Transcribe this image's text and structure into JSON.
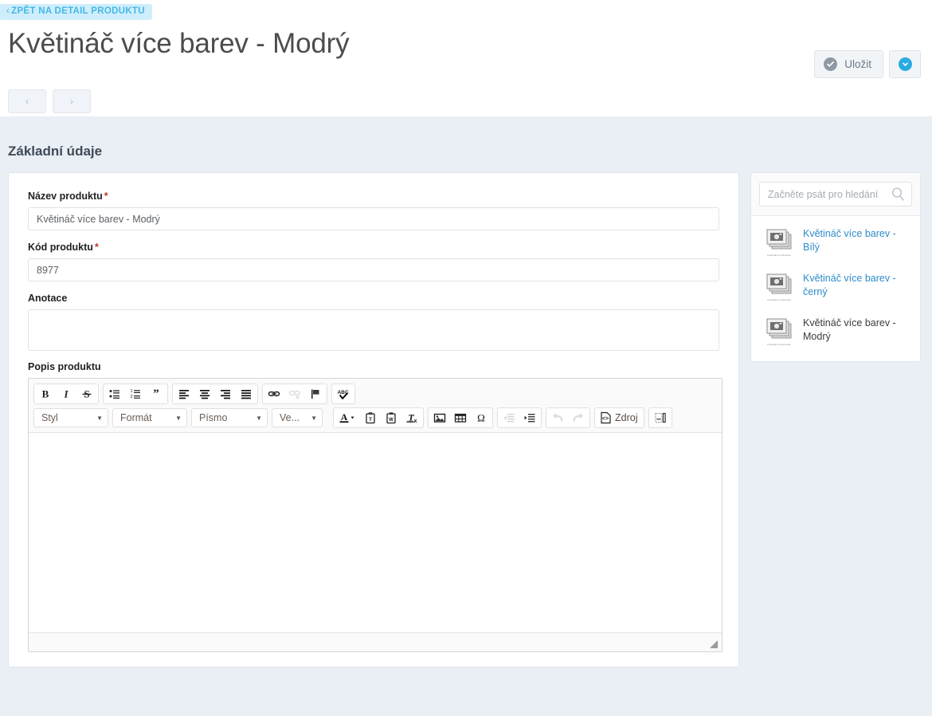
{
  "header": {
    "back_link": "ZPĚT NA DETAIL PRODUKTU",
    "back_chevron": "‹",
    "title": "Květináč více barev - Modrý",
    "save_label": "Uložit",
    "prev_label": "‹",
    "next_label": "›"
  },
  "section": {
    "title": "Základní údaje"
  },
  "form": {
    "name_label": "Název produktu",
    "name_required": "*",
    "name_value": "Květináč více barev - Modrý",
    "code_label": "Kód produktu",
    "code_required": "*",
    "code_value": "8977",
    "annotation_label": "Anotace",
    "annotation_value": "",
    "description_label": "Popis produktu"
  },
  "editor": {
    "row1": [
      {
        "name": "bold",
        "label": "B"
      },
      {
        "name": "italic",
        "label": "I"
      },
      {
        "name": "strike",
        "label": "S"
      },
      {
        "name": "bulleted-list",
        "label": ""
      },
      {
        "name": "numbered-list",
        "label": ""
      },
      {
        "name": "blockquote",
        "label": "”"
      },
      {
        "name": "align-left",
        "label": ""
      },
      {
        "name": "align-center",
        "label": ""
      },
      {
        "name": "align-right",
        "label": ""
      },
      {
        "name": "align-justify",
        "label": ""
      },
      {
        "name": "link",
        "label": ""
      },
      {
        "name": "unlink",
        "label": ""
      },
      {
        "name": "anchor",
        "label": ""
      },
      {
        "name": "spellcheck",
        "label": "ABC"
      }
    ],
    "combos": {
      "style": "Styl",
      "format": "Formát",
      "font": "Písmo",
      "size": "Ve..."
    },
    "source_label": "Zdroj",
    "content": ""
  },
  "sidebar": {
    "search_placeholder": "Začněte psát pro hledání",
    "search_value": "",
    "thumb_caption": "Fotografie se připravuje",
    "items": [
      {
        "label": "Květináč více barev - Bílý",
        "current": false
      },
      {
        "label": "Květináč více barev - černý",
        "current": false
      },
      {
        "label": "Květináč více barev - Modrý",
        "current": true
      }
    ]
  },
  "colors": {
    "accent_blue": "#29abe2",
    "link_blue": "#2e8bc9",
    "page_bg": "#eaeef5",
    "required_red": "#c0392b",
    "back_pill_bg": "#cfeefb"
  }
}
